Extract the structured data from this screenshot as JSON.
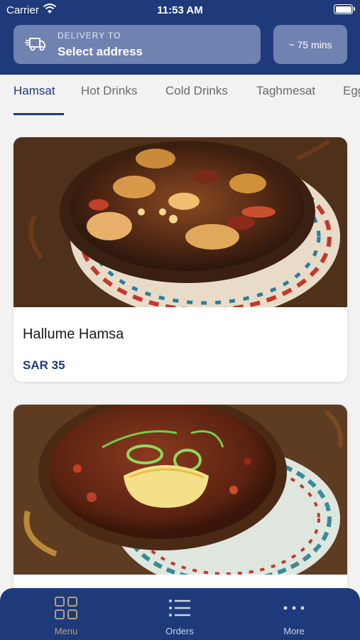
{
  "status_bar": {
    "carrier": "Carrier",
    "time": "11:53 AM"
  },
  "header": {
    "delivery_label": "DELIVERY TO",
    "address_value": "Select address",
    "eta": "~ 75 mins"
  },
  "tabs": [
    "Hamsat",
    "Hot Drinks",
    "Cold Drinks",
    "Taghmesat",
    "Egg"
  ],
  "active_tab": "Hamsat",
  "items": [
    {
      "name": "Hallume Hamsa",
      "price": "SAR 35"
    }
  ],
  "bottom_nav": [
    {
      "label": "Menu",
      "icon": "grid-icon",
      "active": true
    },
    {
      "label": "Orders",
      "icon": "list-icon",
      "active": false
    },
    {
      "label": "More",
      "icon": "more-dots-icon",
      "active": false
    }
  ],
  "colors": {
    "primary": "#1f3a7a",
    "header_box": "#6f82b0",
    "active_nav": "#b59f79"
  }
}
